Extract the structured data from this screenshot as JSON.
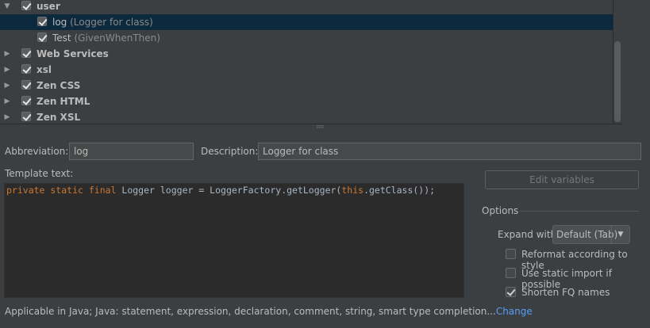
{
  "tree": {
    "groups": [
      {
        "label": "user",
        "expanded": true,
        "checked": true,
        "items": [
          {
            "label": "log",
            "desc": "(Logger for class)",
            "checked": true,
            "selected": true
          },
          {
            "label": "Test",
            "desc": "(GivenWhenThen)",
            "checked": true,
            "selected": false
          }
        ]
      },
      {
        "label": "Web Services",
        "expanded": false,
        "checked": true
      },
      {
        "label": "xsl",
        "expanded": false,
        "checked": true
      },
      {
        "label": "Zen CSS",
        "expanded": false,
        "checked": true
      },
      {
        "label": "Zen HTML",
        "expanded": false,
        "checked": true
      },
      {
        "label": "Zen XSL",
        "expanded": false,
        "checked": true
      }
    ]
  },
  "form": {
    "abbreviation_label": "Abbreviation:",
    "abbreviation_value": "log",
    "description_label": "Description:",
    "description_value": "Logger for class",
    "template_label": "Template text:",
    "template_code": {
      "kw1": "private static final",
      "mid": " Logger logger = LoggerFactory.getLogger(",
      "kw2": "this",
      "end": ".getClass());"
    },
    "edit_variables_label": "Edit variables"
  },
  "options": {
    "title": "Options",
    "expand_with_label": "Expand with",
    "expand_with_value": "Default (Tab)",
    "checkboxes": [
      {
        "label": "Reformat according to style",
        "checked": false
      },
      {
        "label": "Use static import if possible",
        "checked": false
      },
      {
        "label": "Shorten FQ names",
        "checked": true
      }
    ]
  },
  "footer": {
    "applicable_text": "Applicable in Java; Java: statement, expression, declaration, comment, string, smart type completion...",
    "change_link": "Change"
  },
  "colors": {
    "background": "#3c3f41",
    "selection": "#0d293e",
    "editor_bg": "#2b2b2b",
    "keyword": "#cc7832",
    "link": "#589df6"
  }
}
